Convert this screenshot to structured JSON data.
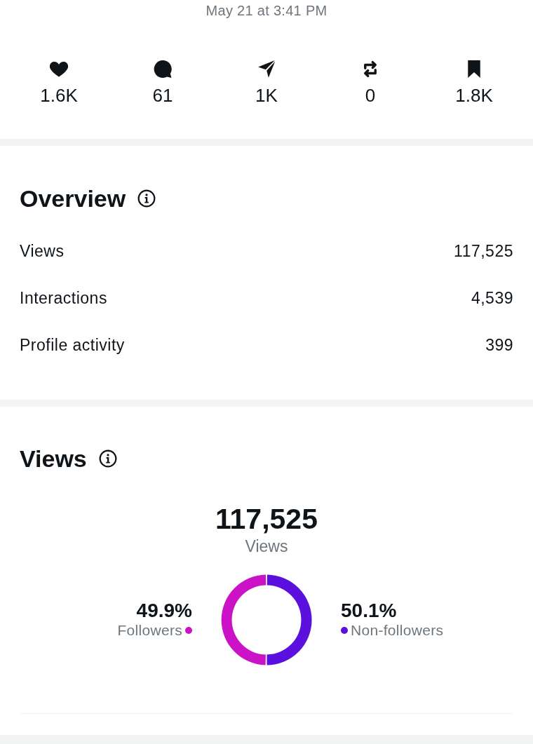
{
  "timestamp": "May 21 at 3:41 PM",
  "stats": [
    {
      "kind": "likes",
      "value": "1.6K"
    },
    {
      "kind": "replies",
      "value": "61"
    },
    {
      "kind": "shares",
      "value": "1K"
    },
    {
      "kind": "reposts",
      "value": "0"
    },
    {
      "kind": "bookmarks",
      "value": "1.8K"
    }
  ],
  "overview": {
    "title": "Overview",
    "rows": [
      {
        "label": "Views",
        "value": "117,525"
      },
      {
        "label": "Interactions",
        "value": "4,539"
      },
      {
        "label": "Profile activity",
        "value": "399"
      }
    ]
  },
  "views": {
    "title": "Views",
    "total": "117,525",
    "total_label": "Views",
    "chart_data": {
      "type": "donut",
      "categories": [
        "Followers",
        "Non-followers"
      ],
      "values": [
        49.9,
        50.1
      ],
      "value_labels": [
        "49.9%",
        "50.1%"
      ],
      "colors": [
        "#cb12c7",
        "#5b10de"
      ]
    }
  }
}
